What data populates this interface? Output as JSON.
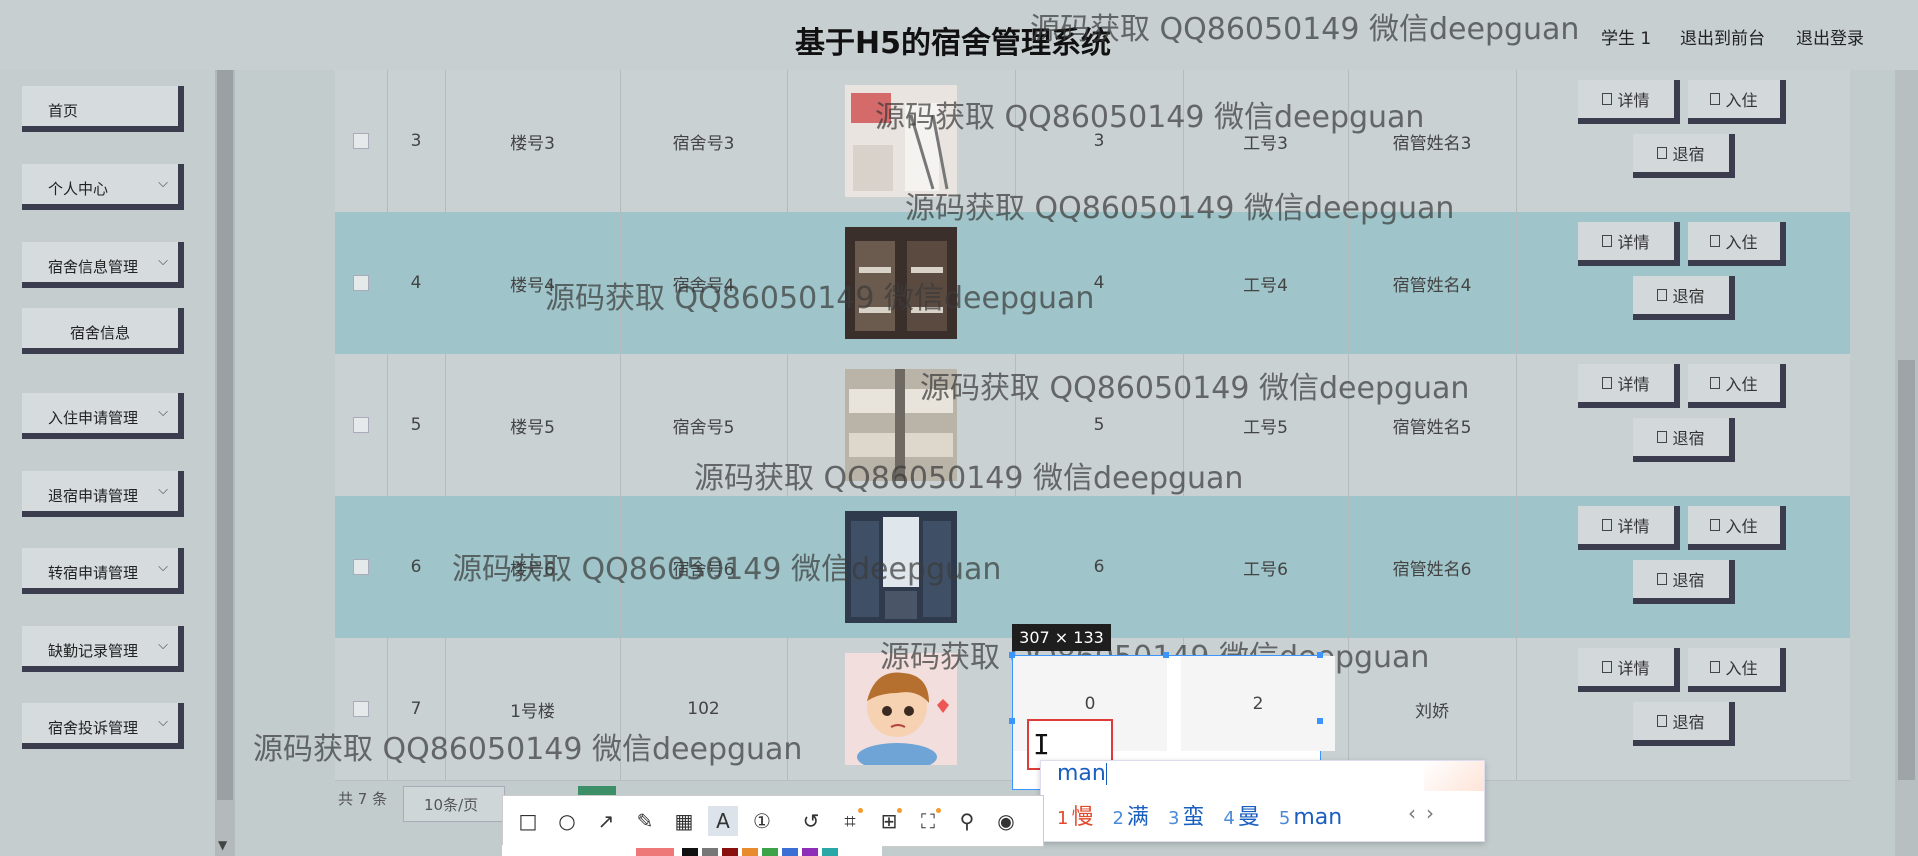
{
  "header": {
    "title": "基于H5的宿舍管理系统",
    "user": "学生 1",
    "back_to_front": "退出到前台",
    "logout": "退出登录"
  },
  "sidebar": {
    "items": [
      {
        "label": "首页",
        "has_chevron": false
      },
      {
        "label": "个人中心",
        "has_chevron": true
      },
      {
        "label": "宿舍信息管理",
        "has_chevron": true
      },
      {
        "label": "宿舍信息",
        "has_chevron": false
      },
      {
        "label": "入住申请管理",
        "has_chevron": true
      },
      {
        "label": "退宿申请管理",
        "has_chevron": true
      },
      {
        "label": "转宿申请管理",
        "has_chevron": true
      },
      {
        "label": "缺勤记录管理",
        "has_chevron": true
      },
      {
        "label": "宿舍投诉管理",
        "has_chevron": true
      }
    ]
  },
  "table": {
    "rows": [
      {
        "index": "3",
        "building": "楼号3",
        "dorm": "宿舍号3",
        "count": "3",
        "staff_id": "工号3",
        "manager": "宿管姓名3",
        "image": "dorm-photo-3"
      },
      {
        "index": "4",
        "building": "楼号4",
        "dorm": "宿舍号4",
        "count": "4",
        "staff_id": "工号4",
        "manager": "宿管姓名4",
        "image": "dorm-photo-4"
      },
      {
        "index": "5",
        "building": "楼号5",
        "dorm": "宿舍号5",
        "count": "5",
        "staff_id": "工号5",
        "manager": "宿管姓名5",
        "image": "dorm-photo-5"
      },
      {
        "index": "6",
        "building": "楼号6",
        "dorm": "宿舍号6",
        "count": "6",
        "staff_id": "工号6",
        "manager": "宿管姓名6",
        "image": "dorm-photo-6"
      },
      {
        "index": "7",
        "building": "1号楼",
        "dorm": "102",
        "count": "0",
        "staff_id": "2",
        "manager": "刘娇",
        "image": "cartoon-boy"
      }
    ],
    "actions": {
      "detail": "详情",
      "checkin": "入住",
      "checkout": "退宿"
    }
  },
  "pagination": {
    "total": "共 7 条",
    "page_size": "10条/页"
  },
  "watermark": "源码获取 QQ86050149 微信deepguan",
  "capture": {
    "size_label": "307 × 133",
    "ime_input": "man",
    "candidates": [
      {
        "n": "1",
        "text": "慢"
      },
      {
        "n": "2",
        "text": "满"
      },
      {
        "n": "3",
        "text": "蛮"
      },
      {
        "n": "4",
        "text": "曼"
      },
      {
        "n": "5",
        "text": "man"
      }
    ],
    "tools": [
      "rectangle-icon",
      "ellipse-icon",
      "arrow-icon",
      "pen-icon",
      "mosaic-icon",
      "text-icon",
      "number-icon",
      "undo-icon",
      "crop-icon",
      "translate-icon",
      "scan-icon",
      "pin-icon",
      "record-icon"
    ]
  },
  "colors": {
    "accent_border": "#3b3c4e",
    "row_alt": "#9fc4c9",
    "pager_active": "#3d8f67",
    "selection": "#3b95ff",
    "ime_first": "#e24a2e"
  }
}
